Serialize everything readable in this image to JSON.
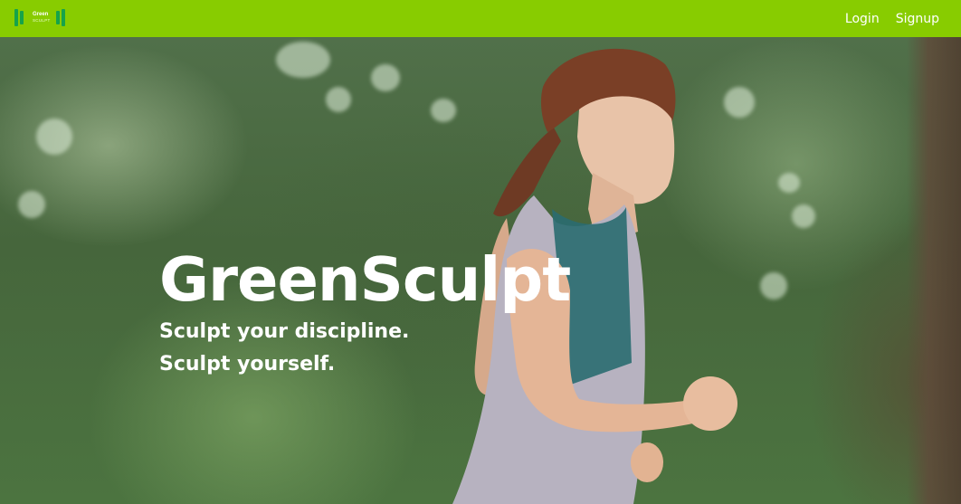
{
  "navbar": {
    "logo": {
      "line1": "Green",
      "line2": "SCULPT"
    },
    "links": {
      "login": "Login",
      "signup": "Signup"
    },
    "background_color": "#88cc00"
  },
  "hero": {
    "title": "GreenSculpt",
    "subtitle_line1": "Sculpt your discipline.",
    "subtitle_line2": "Sculpt yourself.",
    "image_alt": "woman-running-in-forest"
  },
  "colors": {
    "accent": "#88cc00",
    "text_on_hero": "#ffffff"
  }
}
